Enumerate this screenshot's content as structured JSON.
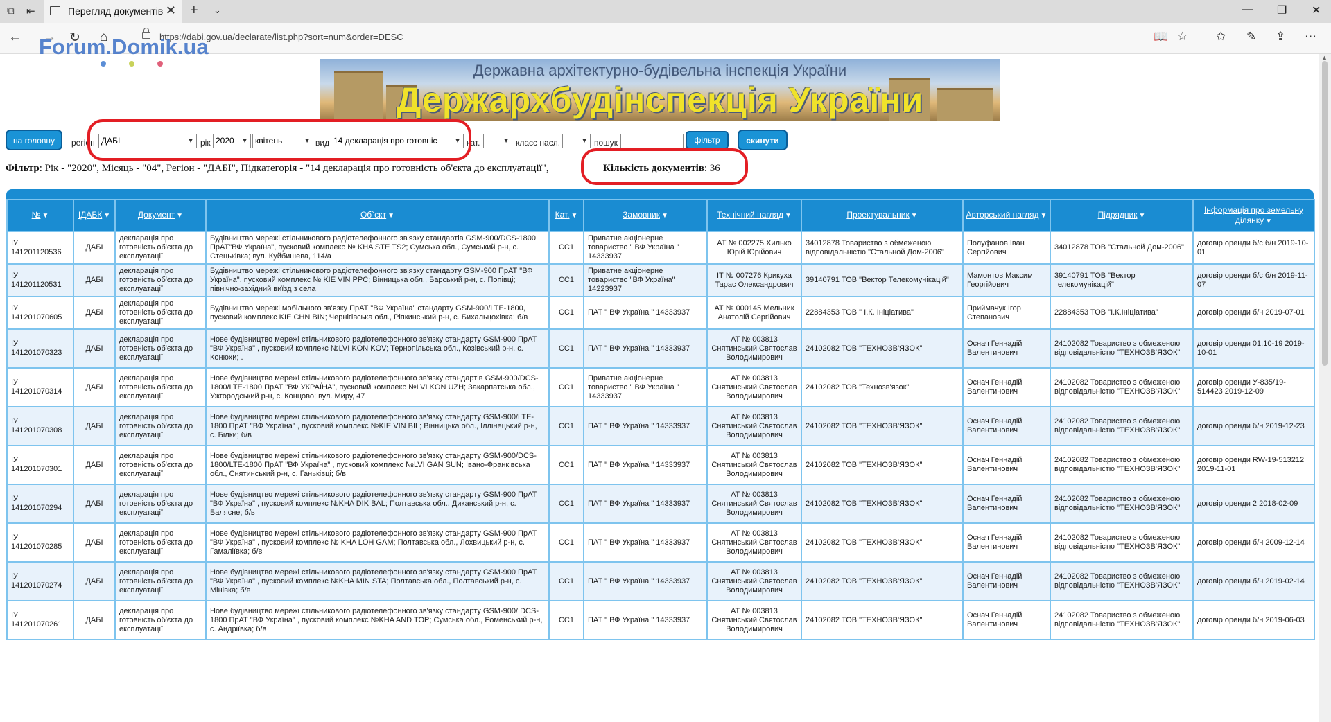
{
  "browser": {
    "tab_title": "Перегляд документів",
    "url": "https://dabi.gov.ua/declarate/list.php?sort=num&order=DESC",
    "new_tab_glyph": "+",
    "close_glyph": "✕"
  },
  "watermark": {
    "text": "Forum.Domik.ua",
    "dots": [
      "#5b8ed6",
      "#c8d25a",
      "#e0607a"
    ]
  },
  "banner": {
    "subtitle": "Державна архітектурно-будівельна інспекція України",
    "title": "Держархбудінспекція України"
  },
  "filters": {
    "home_button": "на головну",
    "region_label": "регіон",
    "region_value": "ДАБІ",
    "year_label": "рік",
    "year_value": "2020",
    "month_value": "квітень",
    "type_label": "вид",
    "type_value": "14 декларація про готовніс",
    "cat_label": "кат.",
    "cat_value": "",
    "class_label": "класс насл.",
    "class_value": "",
    "search_label": "пошук",
    "search_value": "",
    "filter_button": "фільтр",
    "reset_button": "скинути"
  },
  "summary": {
    "filter_label": "Фільтр",
    "filter_text": ": Рік - \"2020\", Місяць - \"04\", Регіон - \"ДАБІ\", Підкатегорія - \"14 декларація про готовність об'єкта до експлуатації\",",
    "count_label": "Кількість документів",
    "count_value": ": 36"
  },
  "table": {
    "headers": [
      "№",
      "ІДАБК",
      "Документ",
      "Об`єкт",
      "Кат.",
      "Замовник",
      "Технічний нагляд",
      "Проектувальник",
      "Авторський нагляд",
      "Підрядник",
      "Інформація про земельну ділянку"
    ],
    "rows": [
      [
        "ІУ 141201120536",
        "ДАБІ",
        "декларація про готовність об'єкта до експлуатації",
        "Будівництво мережі стільникового радіотелефонного зв'язку стандартів GSM-900/DCS-1800 ПрАТ\"ВФ Україна\", пусковий комплекс № KHA STE TS2; Сумська обл., Сумський р-н, с. Стецьківка; вул. Куйбишева, 114/а",
        "СС1",
        "Приватне акціонерне товариство \" ВФ Україна \" 14333937",
        "АТ № 002275 Хилько Юрій Юрійович",
        "34012878 Товариство з обмеженою відповідальністю \"Стальной Дом-2006\"",
        "Полуфанов Іван Сергійович",
        "34012878 ТОВ \"Стальной Дом-2006\"",
        "договір оренди б/с б/н 2019-10-01"
      ],
      [
        "ІУ 141201120531",
        "ДАБІ",
        "декларація про готовність об'єкта до експлуатації",
        "Будівництво мережі стільникового радіотелефонного зв'язку стандарту GSM-900 ПрАТ \"ВФ Україна\", пусковий комплекс № KIE VIN PPC; Вінницька обл., Барський р-н, с. Попівці; північно-західний виїзд з села",
        "СС1",
        "Приватне акціонерне товариство \"ВФ Україна\" 14223937",
        "ІТ № 007276 Крикуха Тарас Олександрович",
        "39140791 ТОВ \"Вектор Телекомунікацій\"",
        "Мамонтов Максим Георгійович",
        "39140791 ТОВ \"Вектор телекомунікацій\"",
        "договір оренди б/с б/н 2019-11-07"
      ],
      [
        "ІУ 141201070605",
        "ДАБІ",
        "декларація про готовність об'єкта до експлуатації",
        "Будівництво мережі мобільного зв'язку ПрАТ \"ВФ Україна\" стандарту GSM-900/LTE-1800, пусковий комплекс KIE CHN BIN; Чернігівська обл., Ріпкинський р-н, с. Бихальцохівка; б/в",
        "СС1",
        "ПАТ \" ВФ Україна \" 14333937",
        "АТ № 000145 Мельник Анатолій Сергійович",
        "22884353 ТОВ \" І.К. Ініціатива\"",
        "Приймачук Ігор Степанович",
        "22884353 ТОВ \"І.К.Ініціатива\"",
        "договір оренди б/н 2019-07-01"
      ],
      [
        "ІУ 141201070323",
        "ДАБІ",
        "декларація про готовність об'єкта до експлуатації",
        "Нове будівництво мережі стільникового радіотелефонного зв'язку стандарту GSM-900 ПрАТ \"ВФ Україна\" , пусковий комплекс №LVI KON KOV; Тернопільська обл., Козівський р-н, с. Конюхи; .",
        "СС1",
        "ПАТ \" ВФ Україна \" 14333937",
        "АТ № 003813 Снятинський Святослав Володимирович",
        "24102082 ТОВ \"ТЕХНОЗВ'ЯЗОК\"",
        "Оснач Геннадій Валентинович",
        "24102082 Товариство з обмеженою відповідальністю \"ТЕХНОЗВ'ЯЗОК\"",
        "договір оренди 01.10-19 2019-10-01"
      ],
      [
        "ІУ 141201070314",
        "ДАБІ",
        "декларація про готовність об'єкта до експлуатації",
        "Нове будівництво мережі стільникового радіотелефонного зв'язку стандартів GSM-900/DCS-1800/LTE-1800 ПрАТ \"ВФ УКРАЇНА\", пусковий комплекс №LVI KON UZH; Закарпатська обл., Ужгородський р-н, с. Концово; вул. Миру, 47",
        "СС1",
        "Приватне акціонерне товариство \" ВФ Україна \" 14333937",
        "АТ № 003813 Снятинський Святослав Володимирович",
        "24102082 ТОВ \"Технозв'язок\"",
        "Оснач Геннадій Валентинович",
        "24102082 Товариство з обмеженою відповідальністю \"ТЕХНОЗВ'ЯЗОК\"",
        "договір оренди У-835/19-514423 2019-12-09"
      ],
      [
        "ІУ 141201070308",
        "ДАБІ",
        "декларація про готовність об'єкта до експлуатації",
        "Нове будівництво мережі стільникового радіотелефонного зв'язку стандарту GSM-900/LTE-1800 ПрАТ \"ВФ Україна\" , пусковий комплекс №KIE VIN BIL; Вінницька обл., Іллінецький р-н, с. Білки; б/в",
        "СС1",
        "ПАТ \" ВФ Україна \" 14333937",
        "АТ № 003813 Снятинський Святослав Володимирович",
        "24102082 ТОВ \"ТЕХНОЗВ'ЯЗОК\"",
        "Оснач Геннадій Валентинович",
        "24102082 Товариство з обмеженою відповідальністю \"ТЕХНОЗВ'ЯЗОК\"",
        "договір оренди б/н 2019-12-23"
      ],
      [
        "ІУ 141201070301",
        "ДАБІ",
        "декларація про готовність об'єкта до експлуатації",
        "Нове будівництво мережі стільникового радіотелефонного зв'язку стандарту GSM-900/DCS-1800/LTE-1800 ПрАТ \"ВФ Україна\" , пусковий комплекс №LVI GAN SUN; Івано-Франківська обл., Снятинський р-н, с. Ганьківці; б/в",
        "СС1",
        "ПАТ \" ВФ Україна \" 14333937",
        "АТ № 003813 Снятинський Святослав Володимирович",
        "24102082 ТОВ \"ТЕХНОЗВ'ЯЗОК\"",
        "Оснач Геннадій Валентинович",
        "24102082 Товариство з обмеженою відповідальністю \"ТЕХНОЗВ'ЯЗОК\"",
        "договір оренди RW-19-513212 2019-11-01"
      ],
      [
        "ІУ 141201070294",
        "ДАБІ",
        "декларація про готовність об'єкта до експлуатації",
        "Нове будівництво мережі стільникового радіотелефонного зв'язку стандарту GSM-900 ПрАТ \"ВФ Україна\" , пусковий комплекс №KHA DIK BAL; Полтавська обл., Диканський р-н, с. Балясне; б/в",
        "СС1",
        "ПАТ \" ВФ Україна \" 14333937",
        "АТ № 003813 Снятинський Святослав Володимирович",
        "24102082 ТОВ \"ТЕХНОЗВ'ЯЗОК\"",
        "Оснач Геннадій Валентинович",
        "24102082 Товариство з обмеженою відповідальністю \"ТЕХНОЗВ'ЯЗОК\"",
        "договір оренди 2 2018-02-09"
      ],
      [
        "ІУ 141201070285",
        "ДАБІ",
        "декларація про готовність об'єкта до експлуатації",
        "Нове будівництво мережі стільникового радіотелефонного зв'язку стандарту GSM-900 ПрАТ \"ВФ Україна\" , пусковий комплекс № KHA LOH GAM; Полтавська обл., Лохвицький р-н, с. Гамаліївка; б/в",
        "СС1",
        "ПАТ \" ВФ Україна \" 14333937",
        "АТ № 003813 Снятинський Святослав Володимирович",
        "24102082 ТОВ \"ТЕХНОЗВ'ЯЗОК\"",
        "Оснач Геннадій Валентинович",
        "24102082 Товариство з обмеженою відповідальністю \"ТЕХНОЗВ'ЯЗОК\"",
        "договір оренди б/н 2009-12-14"
      ],
      [
        "ІУ 141201070274",
        "ДАБІ",
        "декларація про готовність об'єкта до експлуатації",
        "Нове будівництво мережі стільникового радіотелефонного зв'язку стандарту GSM-900 ПрАТ \"ВФ Україна\" , пусковий комплекс №KHA MIN STA; Полтавська обл., Полтавський р-н, с. Мінівка; б/в",
        "СС1",
        "ПАТ \" ВФ Україна \" 14333937",
        "АТ № 003813 Снятинський Святослав Володимирович",
        "24102082 ТОВ \"ТЕХНОЗВ'ЯЗОК\"",
        "Оснач Геннадій Валентинович",
        "24102082 Товариство з обмеженою відповідальністю \"ТЕХНОЗВ'ЯЗОК\"",
        "договір оренди б/н 2019-02-14"
      ],
      [
        "ІУ 141201070261",
        "ДАБІ",
        "декларація про готовність об'єкта до експлуатації",
        "Нове будівництво мережі стільникового радіотелефонного зв'язку стандарту GSM-900/ DCS-1800 ПрАТ \"ВФ Україна\" , пусковий комплекс №KHA AND TOP; Сумська обл., Роменський р-н, с. Андріївка; б/в",
        "СС1",
        "ПАТ \" ВФ Україна \" 14333937",
        "АТ № 003813 Снятинський Святослав Володимирович",
        "24102082 ТОВ \"ТЕХНОЗВ'ЯЗОК\"",
        "Оснач Геннадій Валентинович",
        "24102082 Товариство з обмеженою відповідальністю \"ТЕХНОЗВ'ЯЗОК\"",
        "договір оренди б/н 2019-06-03"
      ]
    ]
  },
  "colors": {
    "accent": "#1a8cd2",
    "highlight_ring": "#e31e24"
  }
}
